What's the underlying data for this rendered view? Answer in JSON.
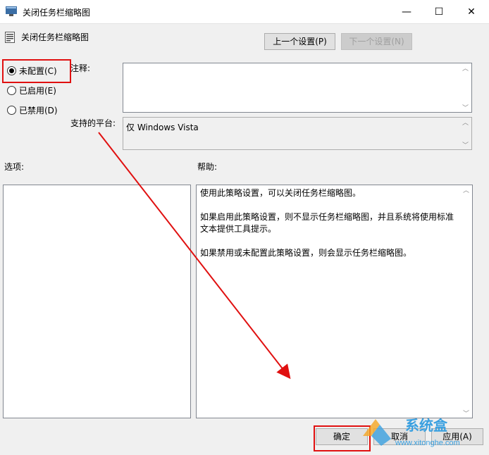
{
  "window": {
    "title": "关闭任务栏缩略图",
    "controls": {
      "minimize": "—",
      "maximize": "☐",
      "close": "✕"
    }
  },
  "policy": {
    "name": "关闭任务栏缩略图",
    "prev_button": "上一个设置(P)",
    "next_button": "下一个设置(N)"
  },
  "radios": [
    {
      "label": "未配置(C)",
      "checked": true
    },
    {
      "label": "已启用(E)",
      "checked": false
    },
    {
      "label": "已禁用(D)",
      "checked": false
    }
  ],
  "labels": {
    "comment": "注释:",
    "platform": "支持的平台:",
    "options": "选项:",
    "help": "帮助:"
  },
  "platform_value": "仅 Windows Vista",
  "help_paragraphs": [
    "使用此策略设置，可以关闭任务栏缩略图。",
    "如果启用此策略设置，则不显示任务栏缩略图，并且系统将使用标准文本提供工具提示。",
    "如果禁用或未配置此策略设置，则会显示任务栏缩略图。"
  ],
  "footer": {
    "ok": "确定",
    "cancel": "取消",
    "apply": "应用(A)"
  },
  "watermark": {
    "text": "系统盒",
    "url": "www.xitonghe.com"
  },
  "colors": {
    "highlight": "#e01010",
    "accent": "#3aa0e0"
  }
}
